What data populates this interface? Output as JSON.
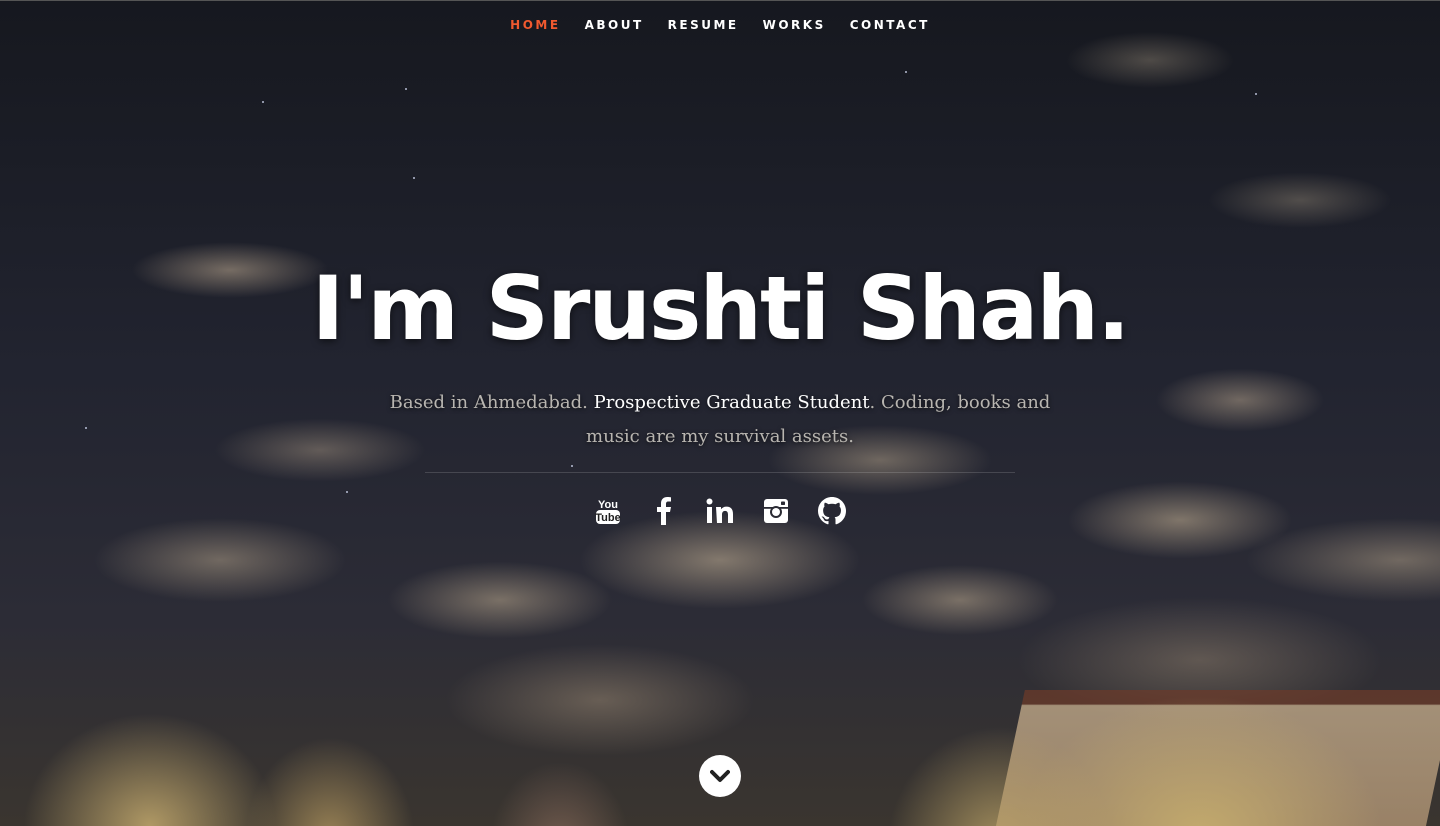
{
  "nav": {
    "items": [
      {
        "label": "Home",
        "active": true
      },
      {
        "label": "About",
        "active": false
      },
      {
        "label": "Resume",
        "active": false
      },
      {
        "label": "Works",
        "active": false
      },
      {
        "label": "Contact",
        "active": false
      }
    ],
    "active_color": "#f0592f"
  },
  "banner": {
    "title": "I'm Srushti Shah.",
    "tagline_part1": "Based in Ahmedabad. ",
    "tagline_highlight": "Prospective Graduate Student",
    "tagline_part2": ". Coding, books and music are my survival assets."
  },
  "social": {
    "icons": [
      "youtube-icon",
      "facebook-icon",
      "linkedin-icon",
      "instagram-icon",
      "github-icon"
    ]
  },
  "scroll": {
    "icon": "chevron-down-icon"
  }
}
